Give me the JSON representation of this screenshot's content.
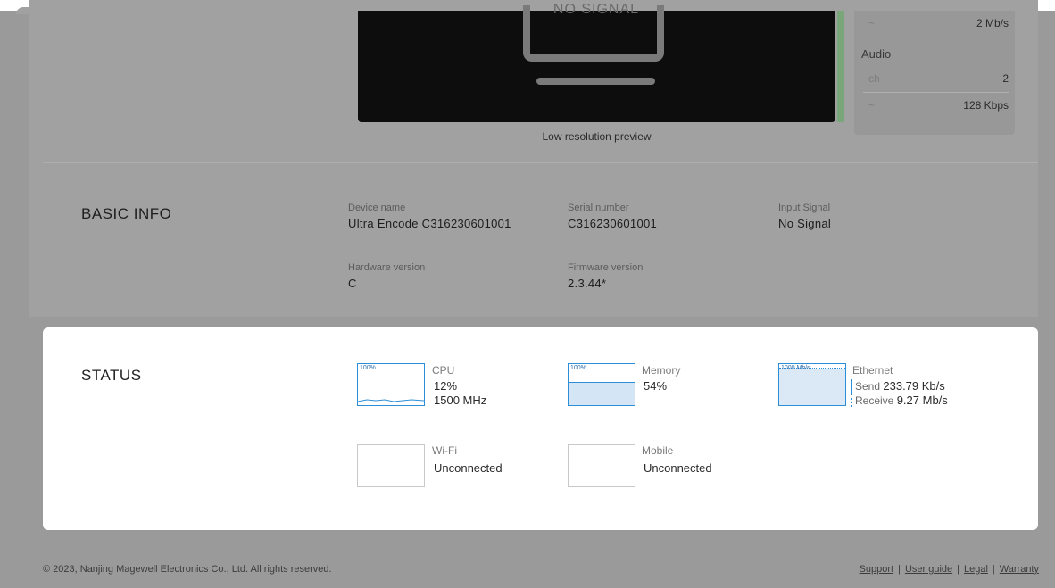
{
  "preview": {
    "signal_text": "NO SIGNAL",
    "caption": "Low resolution preview"
  },
  "stats": {
    "video_bitrate_icon": "wave-icon",
    "video_bitrate": "2 Mb/s",
    "audio_title": "Audio",
    "audio_channels_key": "ch",
    "audio_channels": "2",
    "audio_bitrate_icon": "wave-icon",
    "audio_bitrate": "128 Kbps"
  },
  "basic_info": {
    "title": "BASIC INFO",
    "device_name_label": "Device name",
    "device_name": "Ultra Encode C316230601001",
    "serial_label": "Serial number",
    "serial": "C316230601001",
    "input_signal_label": "Input Signal",
    "input_signal": "No Signal",
    "hardware_label": "Hardware version",
    "hardware": "C",
    "firmware_label": "Firmware version",
    "firmware": "2.3.44*"
  },
  "status": {
    "title": "STATUS",
    "cpu": {
      "label": "CPU",
      "graph_max": "100%",
      "usage": "12%",
      "freq": "1500 MHz",
      "usage_fraction": 0.12
    },
    "memory": {
      "label": "Memory",
      "graph_max": "100%",
      "usage": "54%",
      "usage_fraction": 0.54
    },
    "ethernet": {
      "label": "Ethernet",
      "graph_max": "1000 Mb/s",
      "send_label": "Send",
      "send": "233.79 Kb/s",
      "recv_label": "Receive",
      "recv": "9.27 Mb/s"
    },
    "wifi": {
      "label": "Wi-Fi",
      "value": "Unconnected"
    },
    "mobile": {
      "label": "Mobile",
      "value": "Unconnected"
    }
  },
  "footer": {
    "copyright": "© 2023, Nanjing Magewell Electronics Co., Ltd. All rights reserved.",
    "links": [
      "Support",
      "User guide",
      "Legal",
      "Warranty"
    ]
  },
  "colors": {
    "accent": "#2c8ed6",
    "overlay": "#9a9a9a"
  }
}
